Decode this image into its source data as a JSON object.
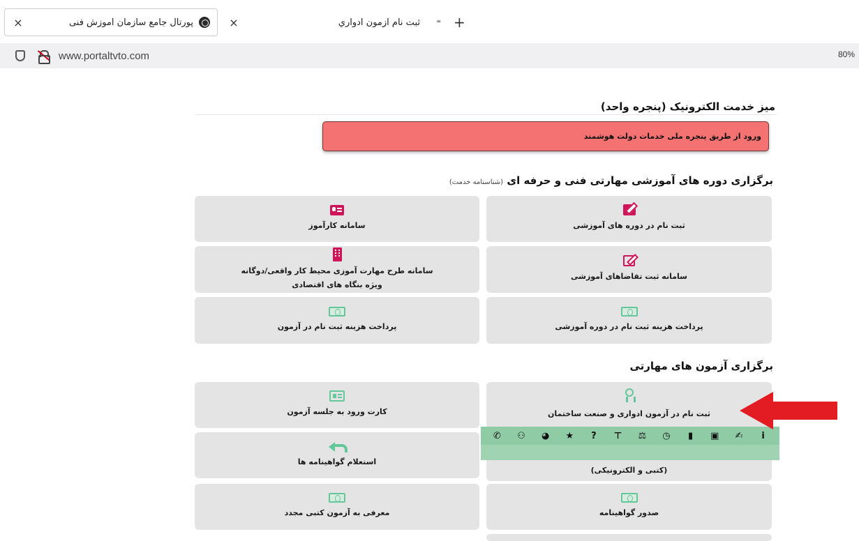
{
  "browser": {
    "tabs": [
      {
        "title": "پورتال جامع سازمان آموزش فنی",
        "active": true
      },
      {
        "title": "ثبت نام آزمون ادواري",
        "active": false
      }
    ],
    "new_tab": "+",
    "close": "×",
    "url": "www.portaltvto.com",
    "zoom": "80%"
  },
  "page": {
    "desk_title": "میز خدمت الکترونیک (پنجره واحد)",
    "gov_login": "ورود از طریق پنجره ملی خدمات دولت هوشمند",
    "section1": {
      "title": "برگزاری دوره های آموزشی مهارتی فنی و حرفه ای",
      "subtitle": "(شناسنامه خدمت)"
    },
    "section2": {
      "title": "برگزاری آزمون های مهارتی"
    },
    "cards_s1": [
      {
        "label": "ثبت نام در دوره های آموزشی",
        "icon": "edit-icon"
      },
      {
        "label": "سامانه کارآموز",
        "icon": "id-card-icon"
      },
      {
        "label": "سامانه ثبت تقاضاهای آموزشی",
        "icon": "edit-outline-icon"
      },
      {
        "label": "سامانه طرح مهارت آموزی محیط کار واقعی/دوگانه",
        "label2": "ویژه بنگاه های اقتصادی",
        "icon": "building-icon"
      },
      {
        "label": "پرداخت هزینه ثبت نام در دوره آموزشی",
        "icon": "money-icon"
      },
      {
        "label": "پرداخت هزینه ثبت نام در آزمون",
        "icon": "money-icon"
      }
    ],
    "cards_s2": [
      {
        "label": "ثبت نام در آزمون ادواری و صنعت ساختمان",
        "icon": "award-icon"
      },
      {
        "label": "کارت ورود به جلسه آزمون",
        "icon": "id-card-outline-icon"
      },
      {
        "label": "استعلام گواهینامه ها",
        "icon": "reply-all-icon"
      },
      {
        "label": "(کتبی و الکترونیکی)",
        "icon": ""
      },
      {
        "label": "صدور گواهینامه",
        "icon": "money-icon"
      },
      {
        "label": "معرفی به آزمون کتبی مجدد",
        "icon": "money-icon"
      }
    ],
    "toolbar_icons": [
      "phone-icon",
      "users-icon",
      "pie-chart-icon",
      "star-icon",
      "question-icon",
      "sitemap-icon",
      "balance-scale-icon",
      "clock-icon",
      "file-icon",
      "money-bill-icon",
      "handshake-icon",
      "info-icon"
    ]
  },
  "colors": {
    "accent_pink": "#d0145a",
    "accent_green": "#63c79a",
    "red_box": "#f57272",
    "toolbar_green": "#8fcca6",
    "card_bg": "#e4e4e4",
    "arrow_red": "#e31b23"
  }
}
